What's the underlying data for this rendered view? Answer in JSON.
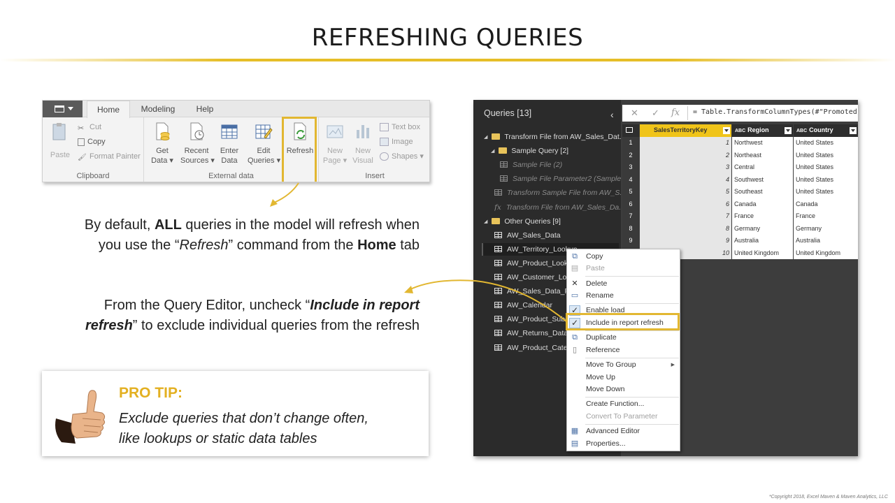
{
  "slide": {
    "title": "REFRESHING QUERIES",
    "copyright": "*Copyright 2018, Excel Maven & Maven Analytics, LLC"
  },
  "ribbon": {
    "tabs": [
      "Home",
      "Modeling",
      "Help"
    ],
    "clipboard": {
      "paste": "Paste",
      "cut": "Cut",
      "copy": "Copy",
      "format_painter": "Format Painter",
      "group": "Clipboard"
    },
    "external": {
      "get_data": "Get\nData ▾",
      "recent_sources": "Recent\nSources ▾",
      "enter_data": "Enter\nData",
      "edit_queries": "Edit\nQueries ▾",
      "refresh": "Refresh",
      "group": "External data"
    },
    "insert": {
      "new_page": "New\nPage ▾",
      "new_visual": "New\nVisual",
      "text_box": "Text box",
      "image": "Image",
      "shapes": "Shapes ▾",
      "group": "Insert"
    }
  },
  "callouts": {
    "first": {
      "p1": "By default, ",
      "b1": "ALL",
      "p2": " queries in the model will refresh when",
      "p3": "you use the “",
      "i1": "Refresh",
      "p4": "” command from the ",
      "b2": "Home",
      "p5": " tab"
    },
    "second": {
      "p1": "From the Query Editor, uncheck “",
      "bi1": "Include in report",
      "bi2": "refresh",
      "p2": "” to exclude individual queries from the refresh"
    }
  },
  "pro_tip": {
    "title": "PRO TIP:",
    "line1": "Exclude queries that don’t change often,",
    "line2": "like lookups or static data tables"
  },
  "query_editor": {
    "pane_title": "Queries [13]",
    "items": [
      {
        "label": "Transform File from AW_Sales_Dat...",
        "kind": "folder"
      },
      {
        "label": "Sample Query [2]",
        "kind": "folder"
      },
      {
        "label": "Sample File (2)",
        "kind": "file-dim"
      },
      {
        "label": "Sample File Parameter2 (Sample...",
        "kind": "param-dim"
      },
      {
        "label": "Transform Sample File from AW_S...",
        "kind": "table-dim"
      },
      {
        "label": "Transform File from AW_Sales_Da...",
        "kind": "fx-dim"
      },
      {
        "label": "Other Queries [9]",
        "kind": "folder"
      },
      {
        "label": "AW_Sales_Data",
        "kind": "table"
      },
      {
        "label": "AW_Territory_Lookup",
        "kind": "table-selected"
      },
      {
        "label": "AW_Product_Lookup",
        "kind": "table"
      },
      {
        "label": "AW_Customer_Lookup",
        "kind": "table"
      },
      {
        "label": "AW_Sales_Data_Fo...",
        "kind": "table"
      },
      {
        "label": "AW_Calendar",
        "kind": "table"
      },
      {
        "label": "AW_Product_Subcategories",
        "kind": "table"
      },
      {
        "label": "AW_Returns_Data",
        "kind": "table"
      },
      {
        "label": "AW_Product_Categories",
        "kind": "table"
      }
    ],
    "formula": "= Table.TransformColumnTypes(#\"Promoted He",
    "formula_buttons": {
      "cancel": "✕",
      "accept": "✓",
      "fx": "fx"
    },
    "columns": [
      "SalesTerritoryKey",
      "Region",
      "Country"
    ],
    "column_type_icons": [
      "",
      "ABC",
      "ABC"
    ],
    "rows": [
      {
        "n": "1",
        "key": "1",
        "region": "Northwest",
        "country": "United States"
      },
      {
        "n": "2",
        "key": "2",
        "region": "Northeast",
        "country": "United States"
      },
      {
        "n": "3",
        "key": "3",
        "region": "Central",
        "country": "United States"
      },
      {
        "n": "4",
        "key": "4",
        "region": "Southwest",
        "country": "United States"
      },
      {
        "n": "5",
        "key": "5",
        "region": "Southeast",
        "country": "United States"
      },
      {
        "n": "6",
        "key": "6",
        "region": "Canada",
        "country": "Canada"
      },
      {
        "n": "7",
        "key": "7",
        "region": "France",
        "country": "France"
      },
      {
        "n": "8",
        "key": "8",
        "region": "Germany",
        "country": "Germany"
      },
      {
        "n": "9",
        "key": "9",
        "region": "Australia",
        "country": "Australia"
      },
      {
        "n": "10",
        "key": "10",
        "region": "United Kingdom",
        "country": "United Kingdom"
      }
    ]
  },
  "context_menu": {
    "copy": "Copy",
    "paste": "Paste",
    "delete": "Delete",
    "rename": "Rename",
    "enable_load": "Enable load",
    "include_refresh": "Include in report refresh",
    "duplicate": "Duplicate",
    "reference": "Reference",
    "move_to_group": "Move To Group",
    "move_up": "Move Up",
    "move_down": "Move Down",
    "create_function": "Create Function...",
    "convert_parameter": "Convert To Parameter",
    "advanced_editor": "Advanced Editor",
    "properties": "Properties...",
    "enable_load_checked": true,
    "include_refresh_checked": true
  },
  "colors": {
    "accent": "#e2b731",
    "pro_tip": "#e3b022",
    "key_header": "#f0c419"
  }
}
